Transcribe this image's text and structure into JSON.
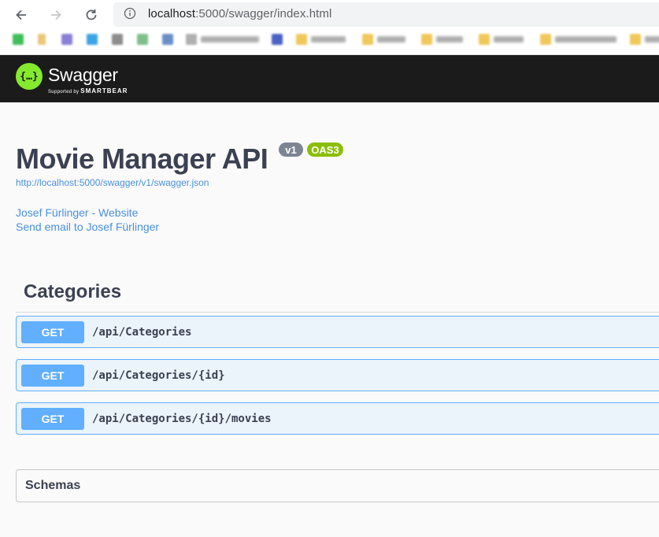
{
  "browser": {
    "url_host": "localhost",
    "url_rest": ":5000/swagger/index.html"
  },
  "swagger": {
    "logo_text": "Swagger",
    "logo_sub_prefix": "Supported by",
    "logo_sub_brand": "SMARTBEAR",
    "logo_glyph": "{…}"
  },
  "info": {
    "title": "Movie Manager API",
    "version_badge": "v1",
    "oas_badge": "OAS3",
    "spec_url": "http://localhost:5000/swagger/v1/swagger.json",
    "website_link": "Josef Fürlinger - Website",
    "email_link": "Send email to Josef Fürlinger"
  },
  "tag": {
    "name": "Categories",
    "operations": [
      {
        "method": "GET",
        "path": "/api/Categories"
      },
      {
        "method": "GET",
        "path": "/api/Categories/{id}"
      },
      {
        "method": "GET",
        "path": "/api/Categories/{id}/movies"
      }
    ]
  },
  "schemas": {
    "label": "Schemas"
  },
  "colors": {
    "get": "#61affe",
    "get_bg": "#ebf3fb",
    "topbar": "#1b1b1b",
    "swagger_green": "#85ea2d",
    "link": "#4990e2"
  }
}
